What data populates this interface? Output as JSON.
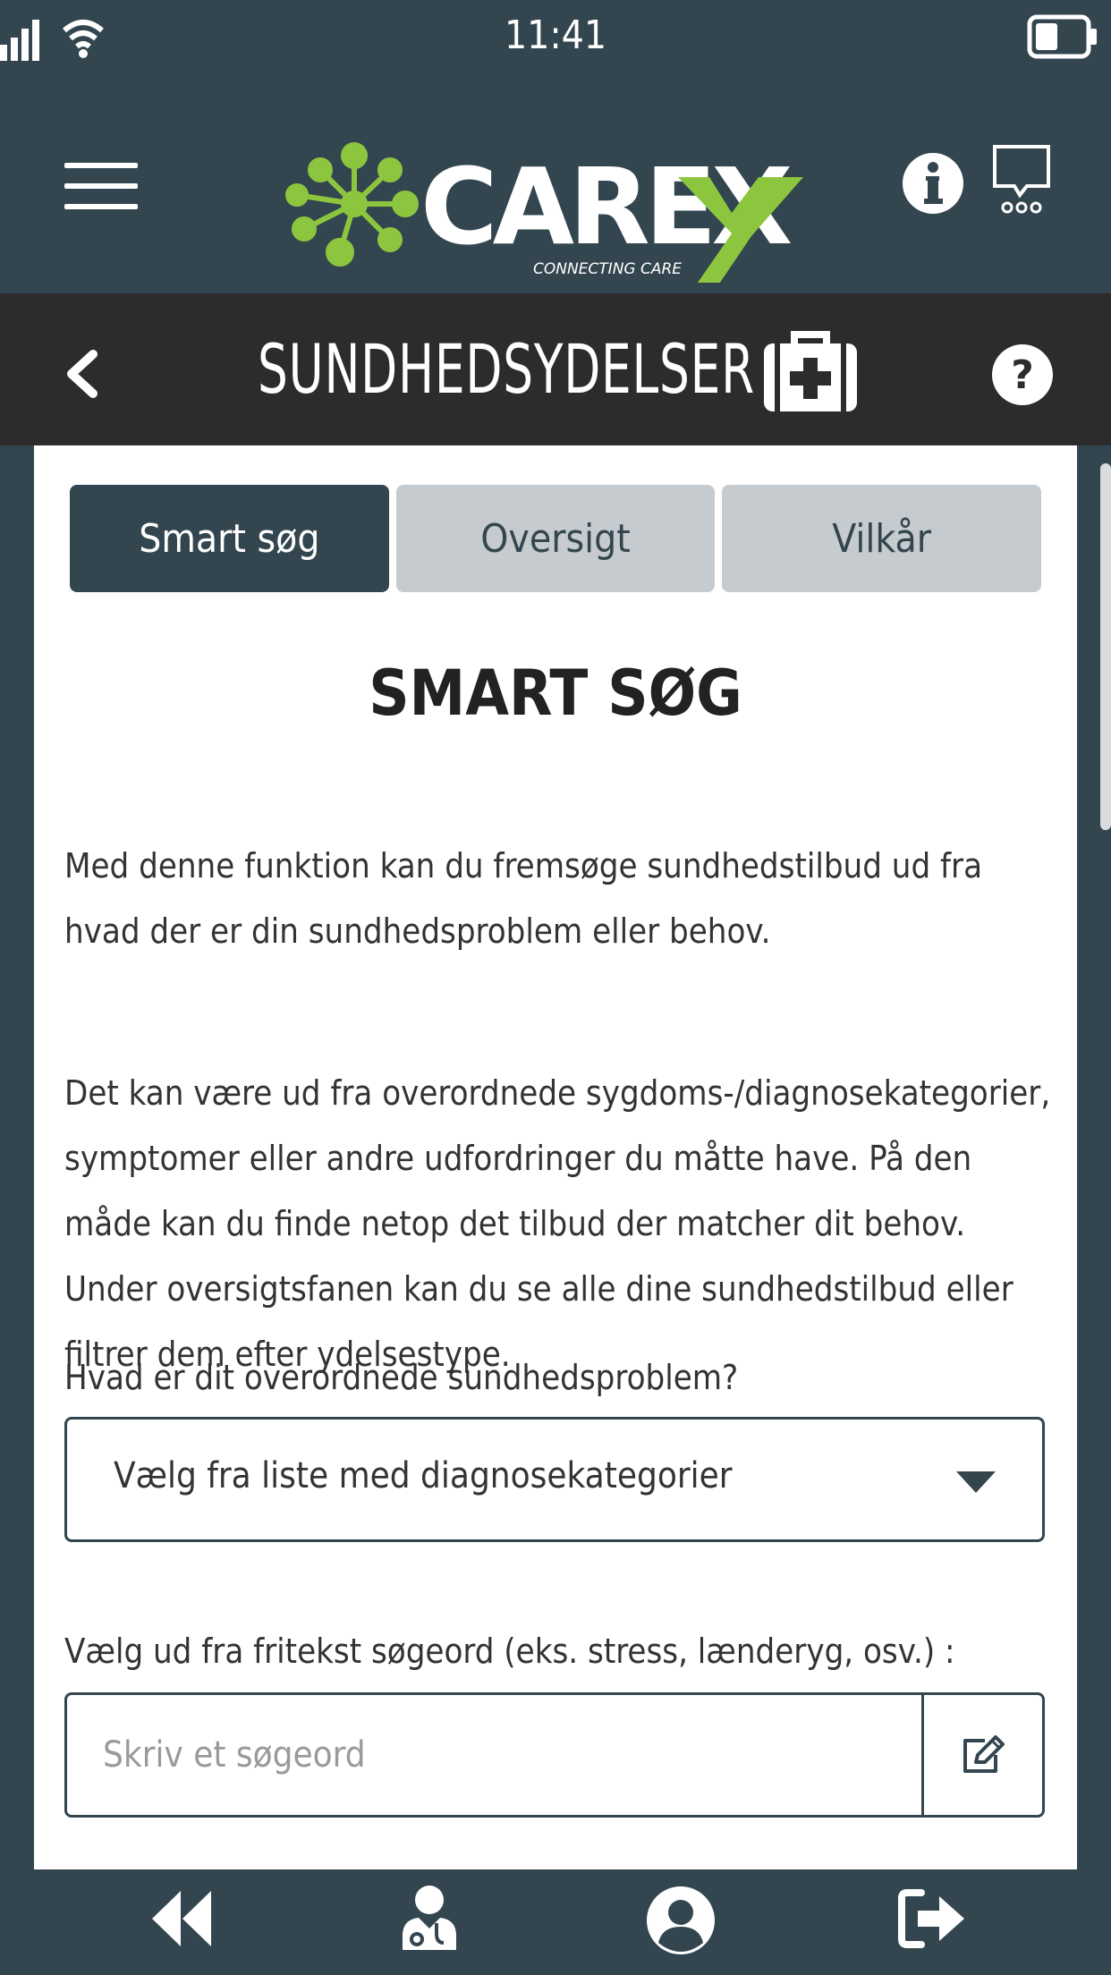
{
  "statusbar": {
    "time": "11:41",
    "icons": [
      "signal-icon",
      "wifi-icon",
      "battery-icon"
    ]
  },
  "header": {
    "logo_text": "CAREX",
    "logo_tagline": "CONNECTING CARE",
    "icons": [
      "menu-icon",
      "info-icon",
      "chat-icon"
    ]
  },
  "titlebar": {
    "title": "SUNDHEDSYDELSER",
    "icons": [
      "back-icon",
      "medkit-icon",
      "help-icon"
    ]
  },
  "tabs": [
    {
      "label": "Smart søg",
      "active": true
    },
    {
      "label": "Oversigt",
      "active": false
    },
    {
      "label": "Vilkår",
      "active": false
    }
  ],
  "main": {
    "heading": "SMART SØG",
    "paragraph1": "Med denne funktion kan du fremsøge sundhedstilbud ud fra hvad der er din sundhedsproblem eller behov.",
    "paragraph2": "Det kan være ud fra overordnede sygdoms-/diagnosekategorier, symptomer eller andre udfordringer du måtte have. På den måde kan du finde netop det tilbud der matcher dit behov. Under oversigtsfanen kan du se alle dine sundhedstilbud eller filtrer dem efter ydelsestype.",
    "category_label": "Hvad er dit overordnede sundhedsproblem?",
    "category_select": "Vælg fra liste med diagnosekategorier",
    "search_label": "Vælg ud fra fritekst søgeord (eks. stress, lænderyg, osv.) :",
    "search_placeholder": "Skriv et søgeord",
    "search_value": ""
  },
  "bottomnav": {
    "icons": [
      "rewind-icon",
      "doctor-icon",
      "profile-icon",
      "logout-icon"
    ]
  },
  "colors": {
    "primary": "#334650",
    "titlebar": "#2c2c2c",
    "accent_green": "#8cc63f",
    "tab_inactive": "#c6cbcf"
  }
}
